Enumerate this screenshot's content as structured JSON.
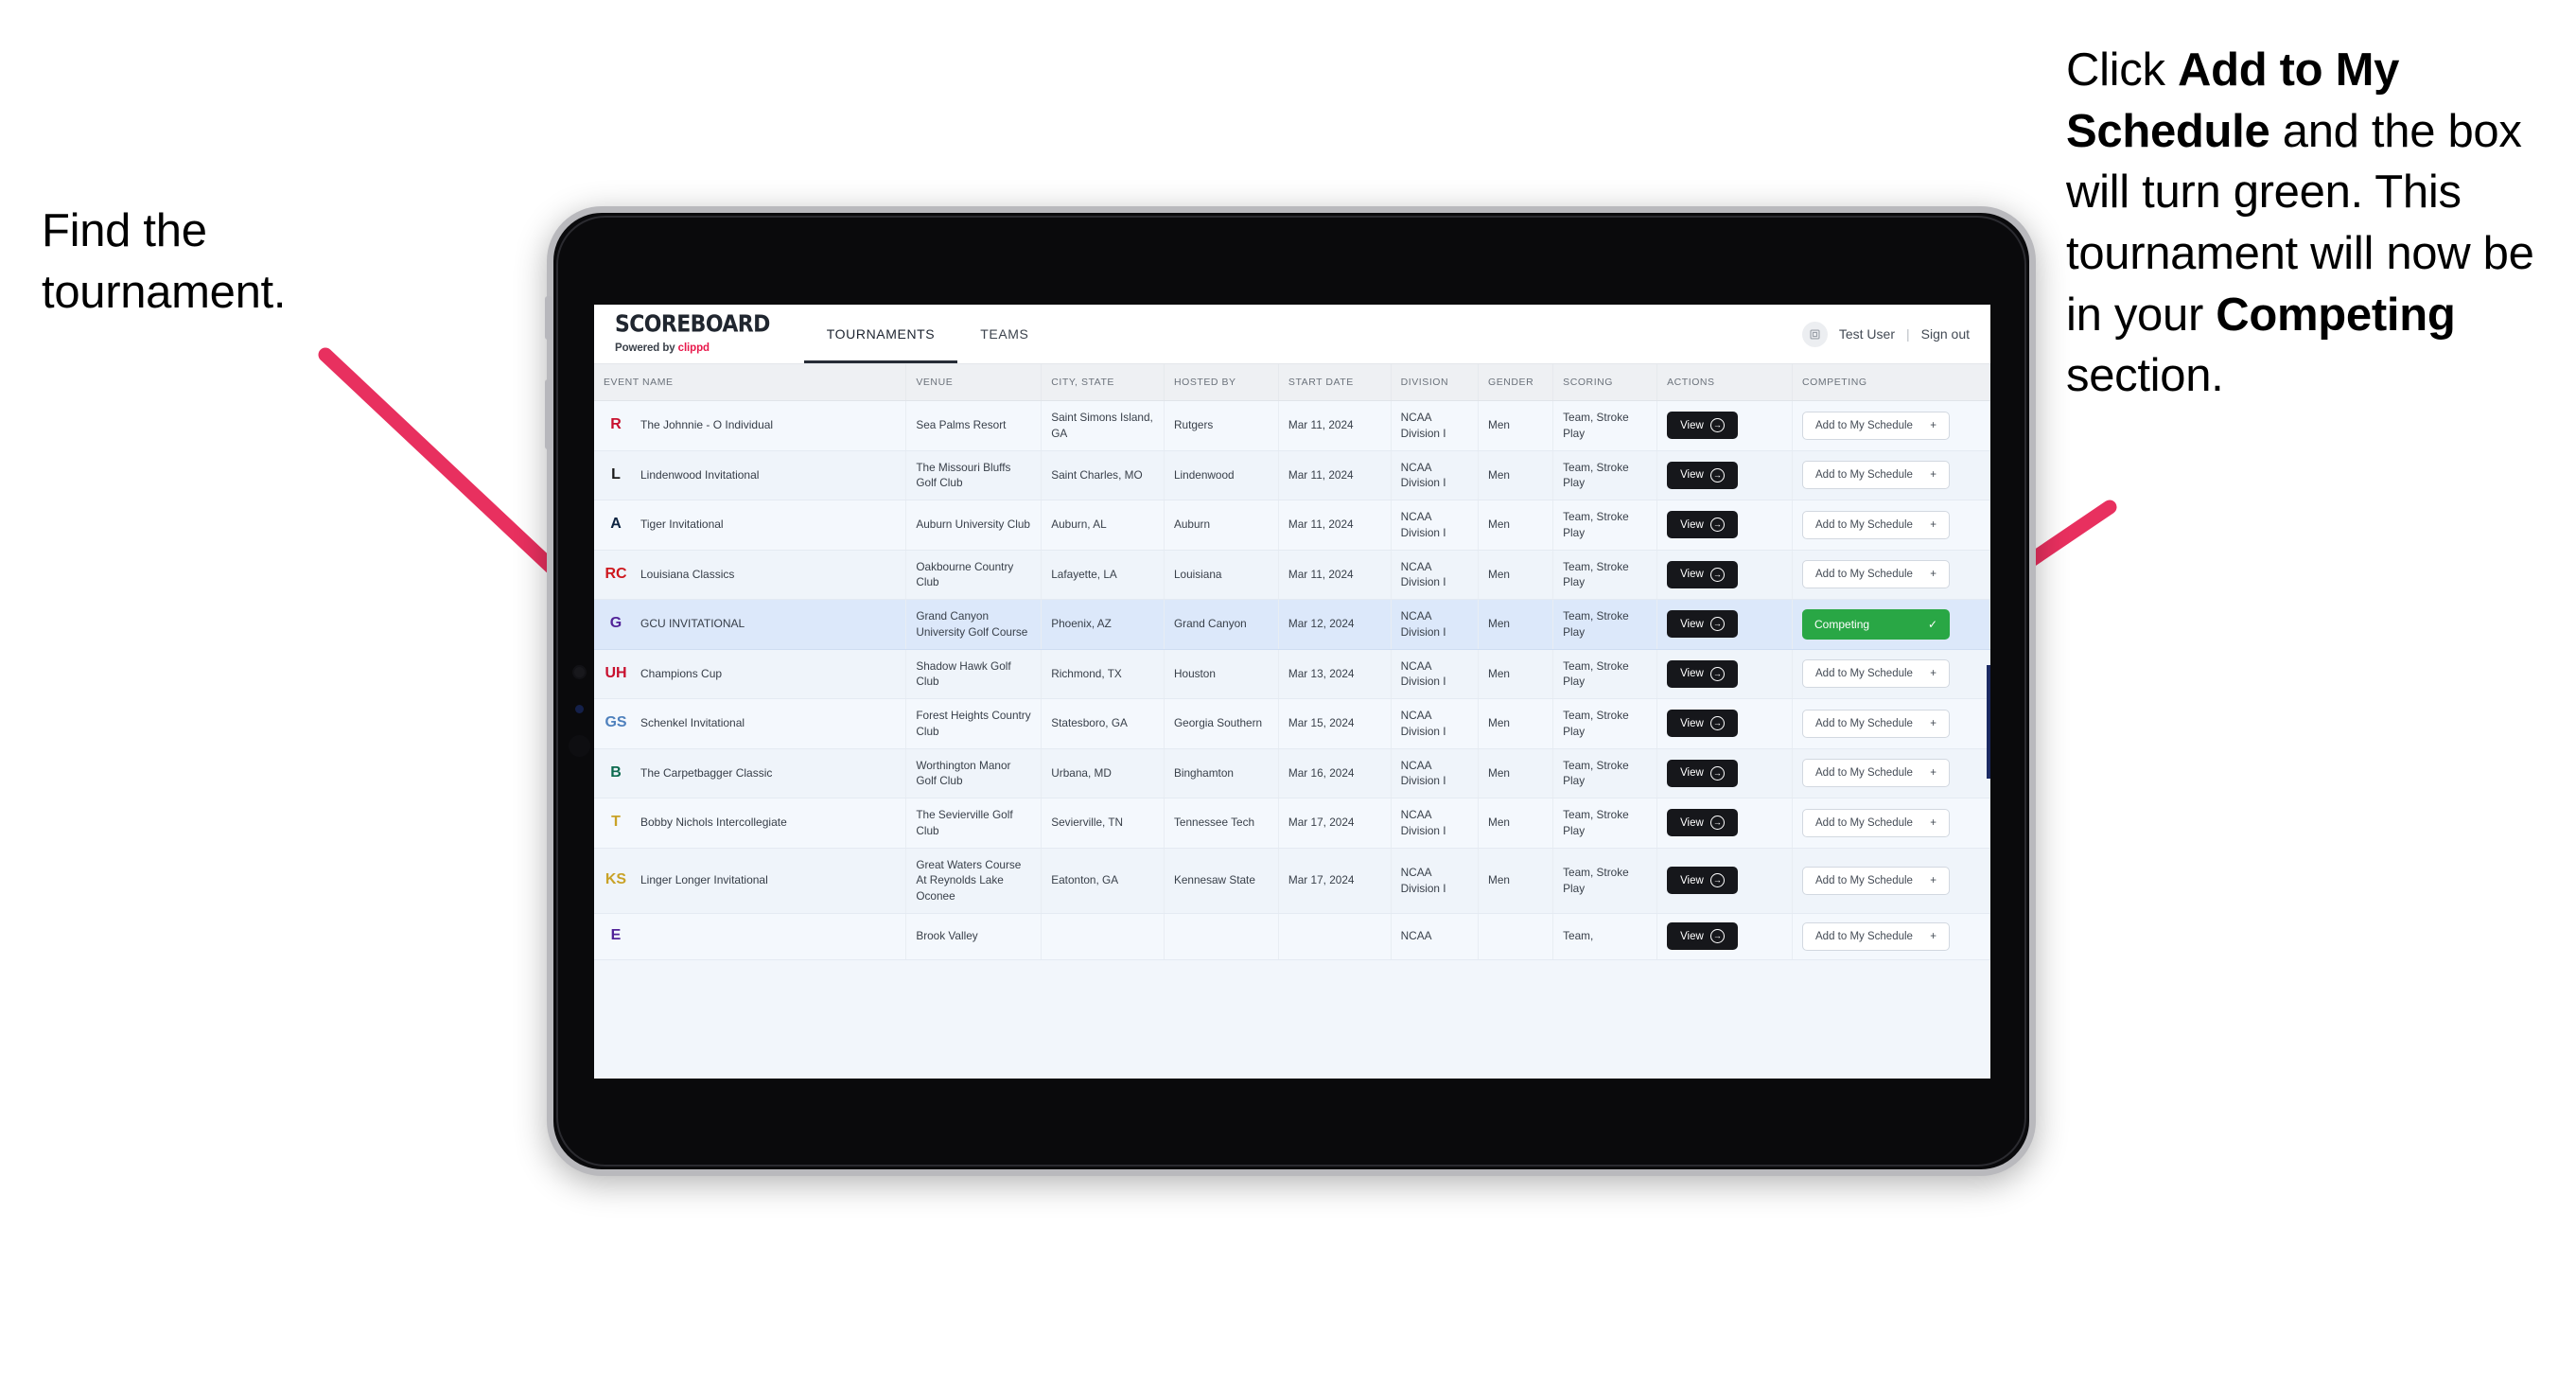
{
  "annotations": {
    "left": "Find the tournament.",
    "right_parts": [
      {
        "text": "Click ",
        "bold": false
      },
      {
        "text": "Add to My Schedule",
        "bold": true
      },
      {
        "text": " and the box will turn green. This tournament will now be in your ",
        "bold": false
      },
      {
        "text": "Competing",
        "bold": true
      },
      {
        "text": " section.",
        "bold": false
      }
    ],
    "arrow_color": "#e8305f"
  },
  "app": {
    "brand": {
      "title": "SCOREBOARD",
      "powered_prefix": "Powered by ",
      "powered_brand": "clippd"
    },
    "nav_tabs": [
      {
        "label": "TOURNAMENTS",
        "active": true
      },
      {
        "label": "TEAMS",
        "active": false
      }
    ],
    "user": {
      "name": "Test User",
      "separator": "|",
      "sign_out": "Sign out",
      "avatar_icon": "user-avatar-icon"
    }
  },
  "table": {
    "columns": [
      "EVENT NAME",
      "VENUE",
      "CITY, STATE",
      "HOSTED BY",
      "START DATE",
      "DIVISION",
      "GENDER",
      "SCORING",
      "ACTIONS",
      "COMPETING"
    ],
    "view_label": "View",
    "add_label": "Add to My Schedule",
    "add_icon": "plus-icon",
    "competing_label": "Competing",
    "competing_icon": "check-icon",
    "competing_color": "#29a745",
    "rows": [
      {
        "event": "The Johnnie - O Individual",
        "venue": "Sea Palms Resort",
        "city": "Saint Simons Island, GA",
        "host": "Rutgers",
        "date": "Mar 11, 2024",
        "division": "NCAA Division I",
        "gender": "Men",
        "scoring": "Team, Stroke Play",
        "competing": false,
        "logo": {
          "text": "R",
          "fg": "#c8102e",
          "bg": "transparent"
        }
      },
      {
        "event": "Lindenwood Invitational",
        "venue": "The Missouri Bluffs Golf Club",
        "city": "Saint Charles, MO",
        "host": "Lindenwood",
        "date": "Mar 11, 2024",
        "division": "NCAA Division I",
        "gender": "Men",
        "scoring": "Team, Stroke Play",
        "competing": false,
        "logo": {
          "text": "L",
          "fg": "#1a1a1a",
          "bg": "transparent"
        }
      },
      {
        "event": "Tiger Invitational",
        "venue": "Auburn University Club",
        "city": "Auburn, AL",
        "host": "Auburn",
        "date": "Mar 11, 2024",
        "division": "NCAA Division I",
        "gender": "Men",
        "scoring": "Team, Stroke Play",
        "competing": false,
        "logo": {
          "text": "A",
          "fg": "#0c2340",
          "bg": "transparent"
        }
      },
      {
        "event": "Louisiana Classics",
        "venue": "Oakbourne Country Club",
        "city": "Lafayette, LA",
        "host": "Louisiana",
        "date": "Mar 11, 2024",
        "division": "NCAA Division I",
        "gender": "Men",
        "scoring": "Team, Stroke Play",
        "competing": false,
        "logo": {
          "text": "RC",
          "fg": "#ce181e",
          "bg": "transparent"
        }
      },
      {
        "event": "GCU INVITATIONAL",
        "venue": "Grand Canyon University Golf Course",
        "city": "Phoenix, AZ",
        "host": "Grand Canyon",
        "date": "Mar 12, 2024",
        "division": "NCAA Division I",
        "gender": "Men",
        "scoring": "Team, Stroke Play",
        "competing": true,
        "selected": true,
        "logo": {
          "text": "G",
          "fg": "#522398",
          "bg": "transparent"
        }
      },
      {
        "event": "Champions Cup",
        "venue": "Shadow Hawk Golf Club",
        "city": "Richmond, TX",
        "host": "Houston",
        "date": "Mar 13, 2024",
        "division": "NCAA Division I",
        "gender": "Men",
        "scoring": "Team, Stroke Play",
        "competing": false,
        "logo": {
          "text": "UH",
          "fg": "#c8102e",
          "bg": "transparent"
        }
      },
      {
        "event": "Schenkel Invitational",
        "venue": "Forest Heights Country Club",
        "city": "Statesboro, GA",
        "host": "Georgia Southern",
        "date": "Mar 15, 2024",
        "division": "NCAA Division I",
        "gender": "Men",
        "scoring": "Team, Stroke Play",
        "competing": false,
        "logo": {
          "text": "GS",
          "fg": "#4f81bd",
          "bg": "transparent"
        }
      },
      {
        "event": "The Carpetbagger Classic",
        "venue": "Worthington Manor Golf Club",
        "city": "Urbana, MD",
        "host": "Binghamton",
        "date": "Mar 16, 2024",
        "division": "NCAA Division I",
        "gender": "Men",
        "scoring": "Team, Stroke Play",
        "competing": false,
        "logo": {
          "text": "B",
          "fg": "#0d6b4f",
          "bg": "transparent"
        }
      },
      {
        "event": "Bobby Nichols Intercollegiate",
        "venue": "The Sevierville Golf Club",
        "city": "Sevierville, TN",
        "host": "Tennessee Tech",
        "date": "Mar 17, 2024",
        "division": "NCAA Division I",
        "gender": "Men",
        "scoring": "Team, Stroke Play",
        "competing": false,
        "logo": {
          "text": "T",
          "fg": "#c9a227",
          "bg": "transparent"
        }
      },
      {
        "event": "Linger Longer Invitational",
        "venue": "Great Waters Course At Reynolds Lake Oconee",
        "city": "Eatonton, GA",
        "host": "Kennesaw State",
        "date": "Mar 17, 2024",
        "division": "NCAA Division I",
        "gender": "Men",
        "scoring": "Team, Stroke Play",
        "competing": false,
        "logo": {
          "text": "KS",
          "fg": "#c9a227",
          "bg": "transparent"
        }
      },
      {
        "event": "",
        "venue": "Brook Valley",
        "city": "",
        "host": "",
        "date": "",
        "division": "NCAA",
        "gender": "",
        "scoring": "Team,",
        "competing": false,
        "partial": true,
        "logo": {
          "text": "E",
          "fg": "#522398",
          "bg": "transparent"
        }
      }
    ]
  }
}
